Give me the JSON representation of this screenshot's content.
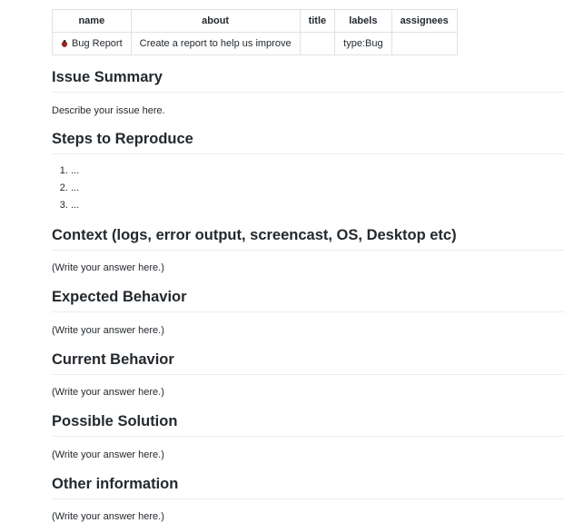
{
  "frontmatter": {
    "headers": [
      "name",
      "about",
      "title",
      "labels",
      "assignees"
    ],
    "row": {
      "name_icon": "lady-beetle-icon",
      "name": "Bug Report",
      "about": "Create a report to help us improve",
      "title": "",
      "labels": "type:Bug",
      "assignees": ""
    }
  },
  "sections": [
    {
      "heading": "Issue Summary",
      "body": "Describe your issue here."
    },
    {
      "heading": "Steps to Reproduce",
      "steps": [
        "...",
        "...",
        "..."
      ]
    },
    {
      "heading": "Context (logs, error output, screencast, OS, Desktop etc)",
      "body": "(Write your answer here.)"
    },
    {
      "heading": "Expected Behavior",
      "body": "(Write your answer here.)"
    },
    {
      "heading": "Current Behavior",
      "body": "(Write your answer here.)"
    },
    {
      "heading": "Possible Solution",
      "body": "(Write your answer here.)"
    },
    {
      "heading": "Other information",
      "body": "(Write your answer here.)"
    }
  ],
  "colors": {
    "text": "#24292e",
    "border": "#dfe2e5",
    "rule": "#eaecef",
    "bug_red": "#c0392b"
  }
}
